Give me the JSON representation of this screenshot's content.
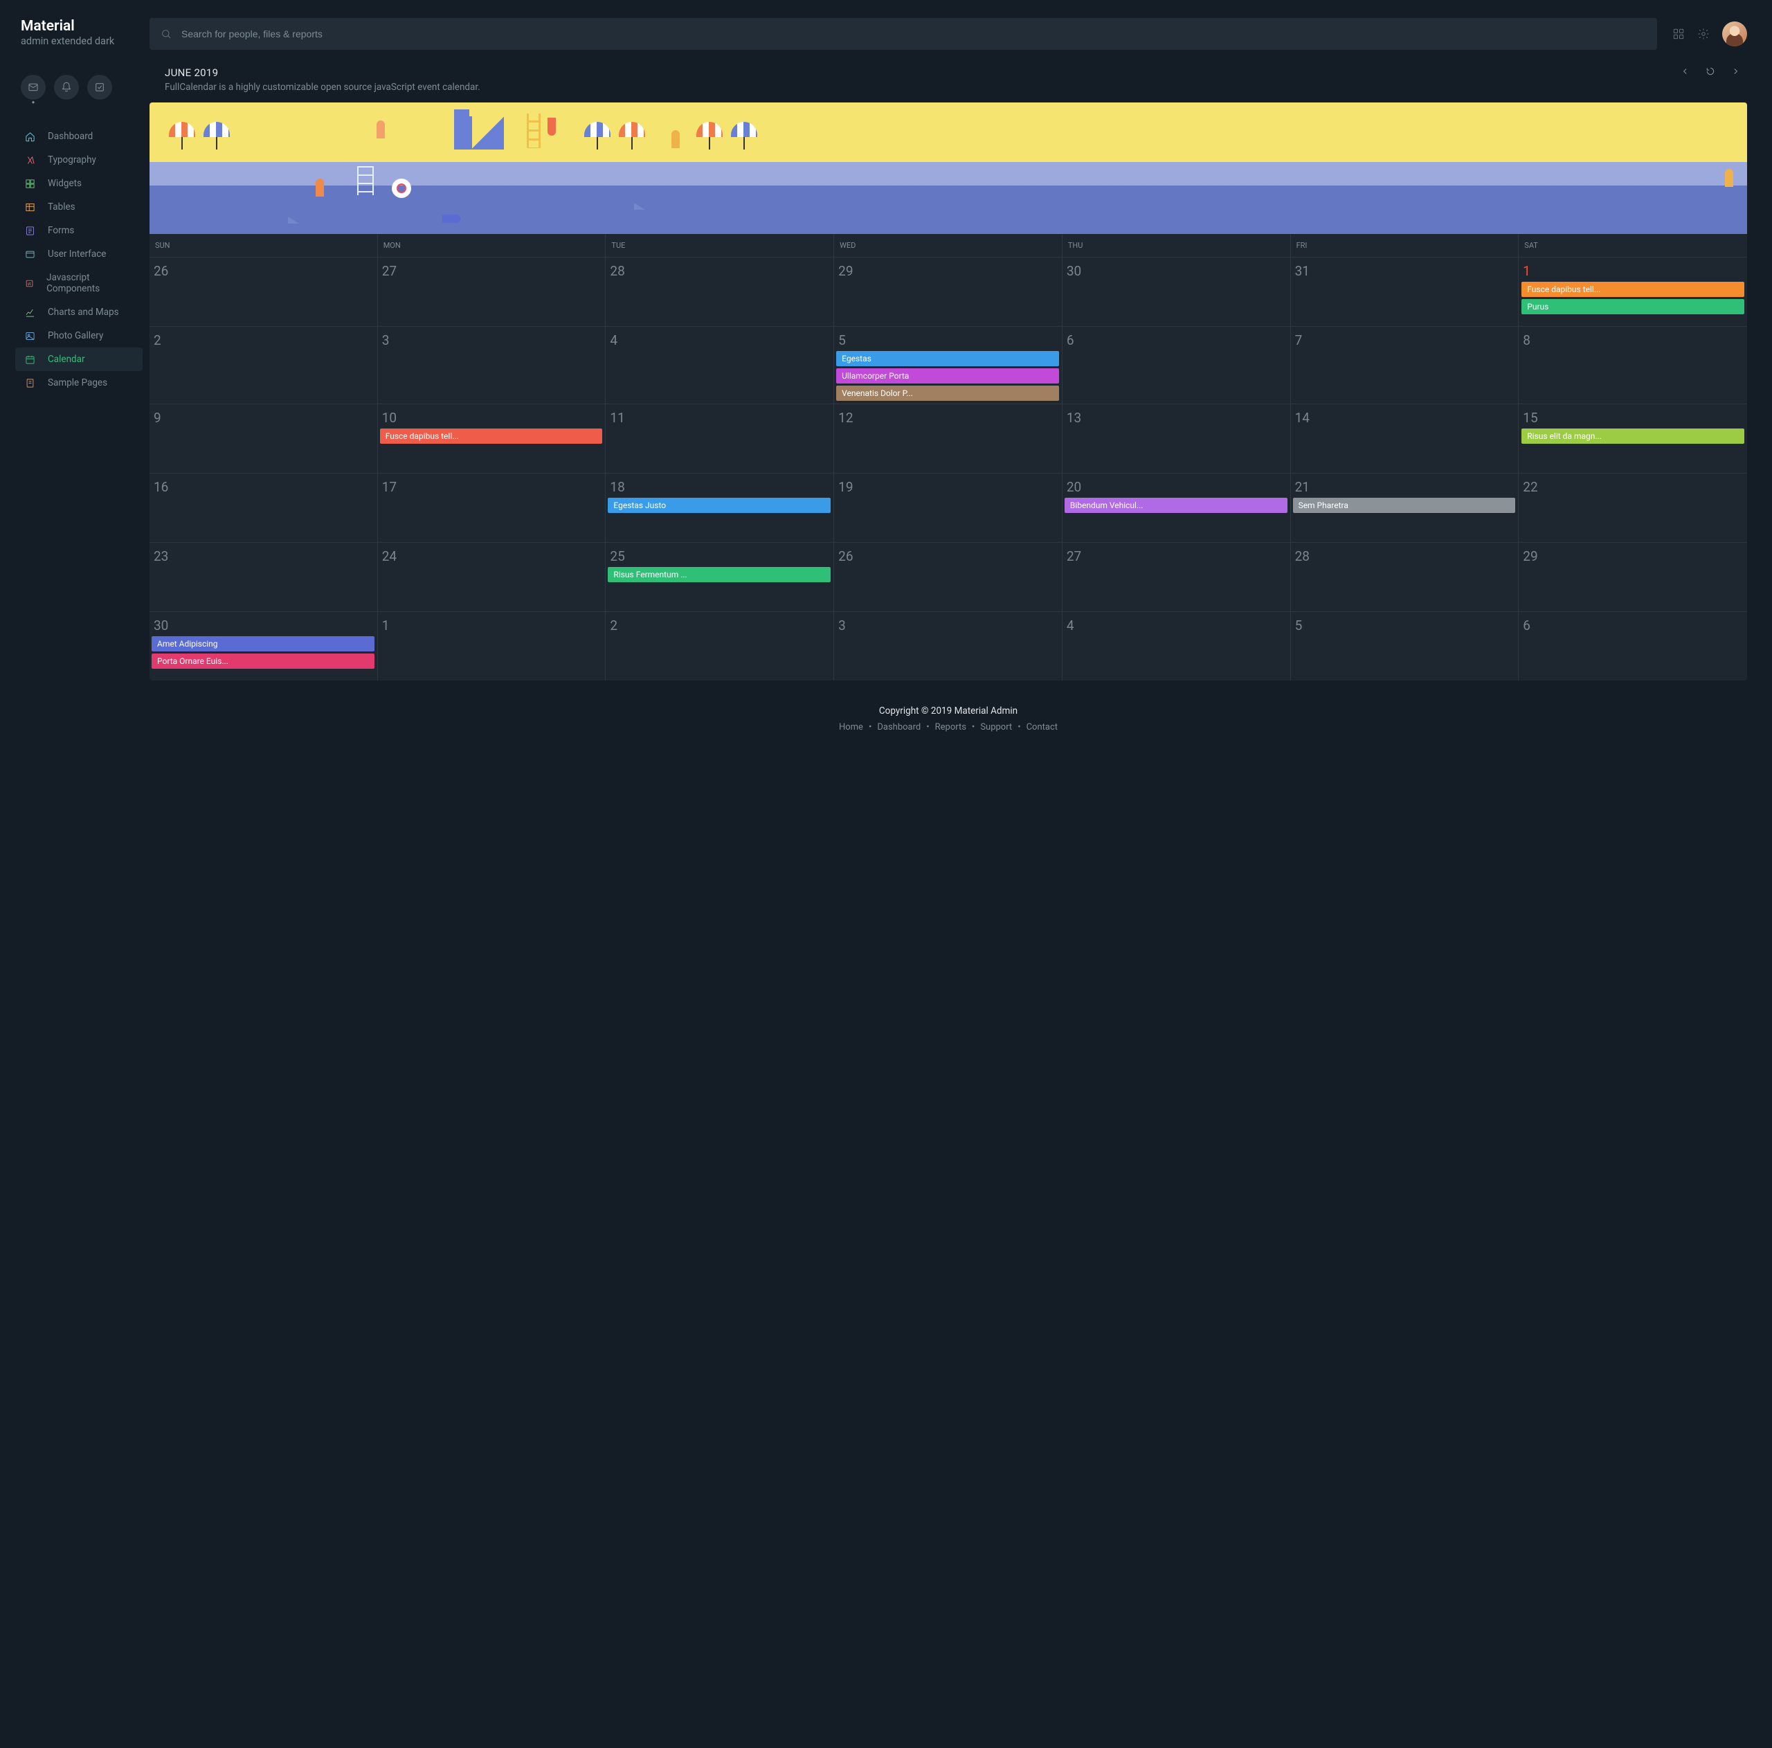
{
  "logo": {
    "title": "Material",
    "subtitle": "admin extended dark"
  },
  "search": {
    "placeholder": "Search for people, files & reports"
  },
  "sidebar": {
    "items": [
      {
        "label": "Dashboard",
        "icon": "home-icon",
        "color": "#6cc9e6"
      },
      {
        "label": "Typography",
        "icon": "type-icon",
        "color": "#e66a6a"
      },
      {
        "label": "Widgets",
        "icon": "grid-icon",
        "color": "#6cc97d"
      },
      {
        "label": "Tables",
        "icon": "table-icon",
        "color": "#e6a75e"
      },
      {
        "label": "Forms",
        "icon": "form-icon",
        "color": "#8b7de0"
      },
      {
        "label": "User Interface",
        "icon": "ui-icon",
        "color": "#5fb7c9"
      },
      {
        "label": "Javascript Components",
        "icon": "js-icon",
        "color": "#e07a7a"
      },
      {
        "label": "Charts and Maps",
        "icon": "chart-icon",
        "color": "#7fc97f"
      },
      {
        "label": "Photo Gallery",
        "icon": "image-icon",
        "color": "#6a9ed6"
      },
      {
        "label": "Calendar",
        "icon": "calendar-icon",
        "color": "#2fbf76"
      },
      {
        "label": "Sample Pages",
        "icon": "pages-icon",
        "color": "#d98e5e"
      }
    ],
    "active_index": 9
  },
  "page": {
    "title": "JUNE 2019",
    "subtitle": "FullCalendar is a highly customizable open source javaScript event calendar."
  },
  "calendar": {
    "day_headers": [
      "SUN",
      "MON",
      "TUE",
      "WED",
      "THU",
      "FRI",
      "SAT"
    ],
    "today": "1",
    "weeks": [
      [
        {
          "num": "26"
        },
        {
          "num": "27"
        },
        {
          "num": "28"
        },
        {
          "num": "29"
        },
        {
          "num": "30"
        },
        {
          "num": "31"
        },
        {
          "num": "1",
          "today": true,
          "events": [
            {
              "label": "Fusce dapibus tell...",
              "color": "#f58c2e"
            },
            {
              "label": "Purus",
              "color": "#2fbf76"
            }
          ]
        }
      ],
      [
        {
          "num": "2"
        },
        {
          "num": "3"
        },
        {
          "num": "4"
        },
        {
          "num": "5",
          "events": [
            {
              "label": "Egestas",
              "color": "#3a9be8",
              "wide": true
            },
            {
              "label": "Ullamcorper Porta",
              "color": "#c14ad9",
              "wide": true
            },
            {
              "label": "Venenatis Dolor P...",
              "color": "#a18061",
              "wide": true
            }
          ]
        },
        {
          "num": "6"
        },
        {
          "num": "7"
        },
        {
          "num": "8"
        }
      ],
      [
        {
          "num": "9"
        },
        {
          "num": "10",
          "events": [
            {
              "label": "Fusce dapibus tell...",
              "color": "#ef5c49",
              "wide": true
            }
          ]
        },
        {
          "num": "11"
        },
        {
          "num": "12"
        },
        {
          "num": "13"
        },
        {
          "num": "14"
        },
        {
          "num": "15",
          "events": [
            {
              "label": "Risus elit da magn...",
              "color": "#9ccc44"
            }
          ]
        }
      ],
      [
        {
          "num": "16"
        },
        {
          "num": "17"
        },
        {
          "num": "18",
          "events": [
            {
              "label": "Egestas Justo",
              "color": "#3a9be8",
              "wide": true
            }
          ]
        },
        {
          "num": "19"
        },
        {
          "num": "20",
          "events": [
            {
              "label": "Bibendum Vehicul...",
              "color": "#b06ae6",
              "wide": true
            }
          ]
        },
        {
          "num": "21",
          "events": [
            {
              "label": "Sem Pharetra",
              "color": "#8b9298",
              "wide": true
            }
          ]
        },
        {
          "num": "22"
        }
      ],
      [
        {
          "num": "23"
        },
        {
          "num": "24"
        },
        {
          "num": "25",
          "events": [
            {
              "label": "Risus Fermentum ...",
              "color": "#2fbf76",
              "wide": true
            }
          ]
        },
        {
          "num": "26"
        },
        {
          "num": "27"
        },
        {
          "num": "28"
        },
        {
          "num": "29"
        }
      ],
      [
        {
          "num": "30",
          "events": [
            {
              "label": "Amet Adipiscing",
              "color": "#5a6bd4",
              "wide": true
            },
            {
              "label": "Porta Ornare Euis...",
              "color": "#e23a6d",
              "wide": true
            }
          ]
        },
        {
          "num": "1"
        },
        {
          "num": "2"
        },
        {
          "num": "3"
        },
        {
          "num": "4"
        },
        {
          "num": "5"
        },
        {
          "num": "6"
        }
      ]
    ]
  },
  "footer": {
    "copyright": "Copyright © 2019 Material Admin",
    "links": [
      "Home",
      "Dashboard",
      "Reports",
      "Support",
      "Contact"
    ]
  }
}
